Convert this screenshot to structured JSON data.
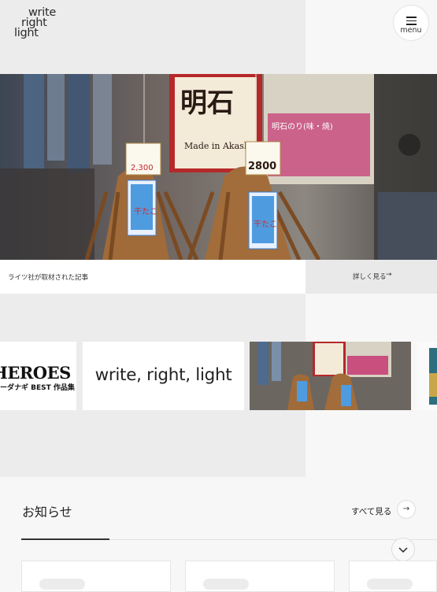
{
  "logo": {
    "line1": "write",
    "line2": "right",
    "line3": "light"
  },
  "menu": {
    "label": "menu",
    "icon": "hamburger-icon"
  },
  "hero": {
    "caption": "ライツ社が取材された記事",
    "more_label": "詳しく見る",
    "more_arrow": "→",
    "sign_main": "明石",
    "sign_sub": "Made in Akashi",
    "tag_left_price": "2,300",
    "tag_right_price": "2800",
    "banner_text": "明石のり(味・焼)",
    "fish_label": "干たこ"
  },
  "carousel": {
    "items": [
      {
        "big": "HEROES",
        "small": "ーダナギ BEST 作品集"
      },
      {
        "text": "write, right, light"
      },
      {
        "image": "dried-octopus-photo"
      },
      {
        "image": "book-cover-partial"
      }
    ]
  },
  "notice": {
    "title": "お知らせ",
    "see_all": "すべて見る",
    "see_all_arrow": "→"
  },
  "colors": {
    "page_bg": "#f7f7f7",
    "panel_bg": "#ececec",
    "text": "#222222"
  }
}
